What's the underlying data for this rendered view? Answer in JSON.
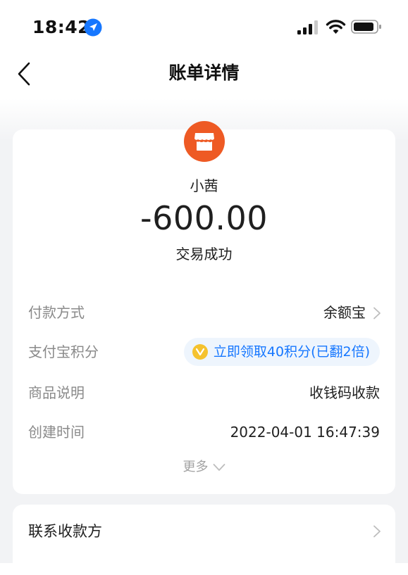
{
  "status_bar": {
    "time": "18:42",
    "icons": [
      "location-arrow-icon",
      "cellular-signal-icon",
      "wifi-icon",
      "battery-icon"
    ]
  },
  "nav": {
    "back_icon": "chevron-left-icon",
    "title": "账单详情"
  },
  "transaction": {
    "merchant_icon": "storefront-icon",
    "merchant_icon_color": "#ee5a24",
    "merchant_name": "小茜",
    "amount": "-600.00",
    "status": "交易成功"
  },
  "details": {
    "payment_method": {
      "label": "付款方式",
      "value": "余额宝"
    },
    "points": {
      "label": "支付宝积分",
      "value": "立即领取40积分(已翻2倍)",
      "icon": "points-coin-icon"
    },
    "product": {
      "label": "商品说明",
      "value": "收钱码收款"
    },
    "created": {
      "label": "创建时间",
      "value": "2022-04-01 16:47:39"
    }
  },
  "more": {
    "label": "更多"
  },
  "contact": {
    "label": "联系收款方"
  },
  "colors": {
    "accent_blue": "#1677ff",
    "pill_background": "#eef5fd",
    "label_gray": "#8a8a8a",
    "page_background": "#f2f3f5"
  }
}
